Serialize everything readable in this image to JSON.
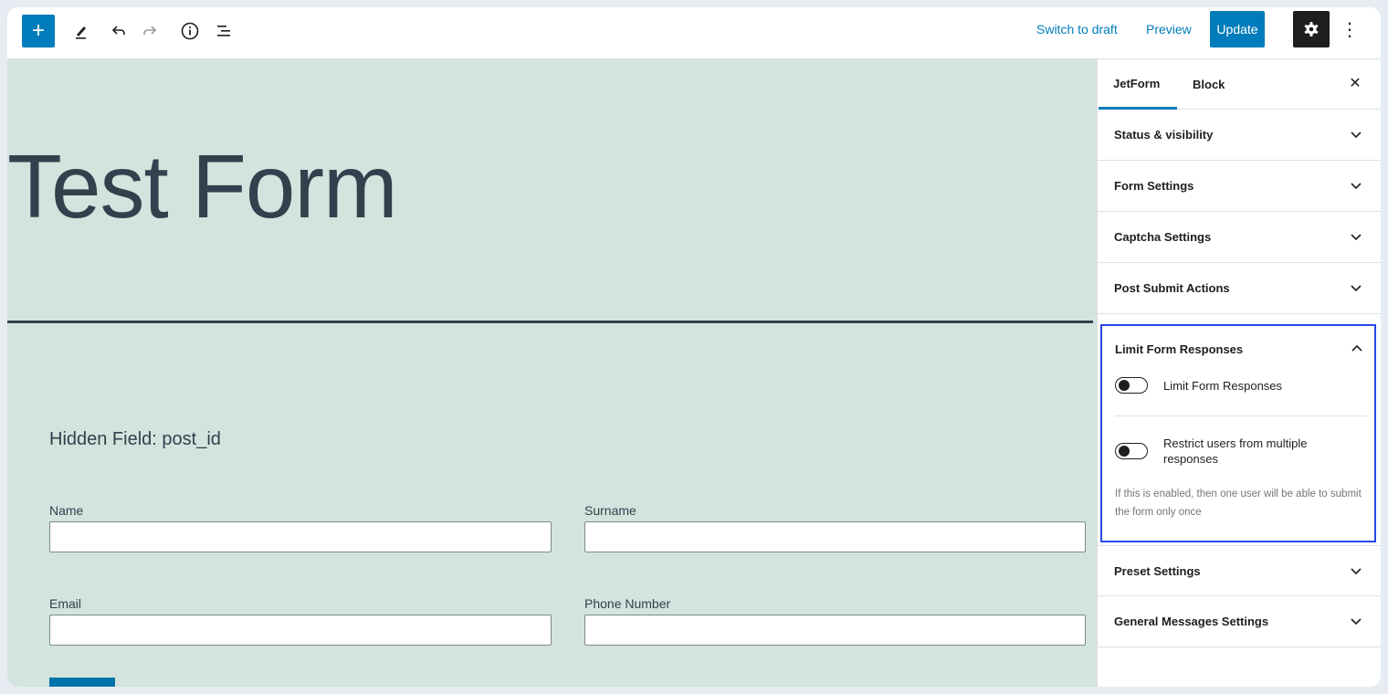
{
  "toolbar": {
    "add_icon": "plus-icon",
    "tools_icon": "pencil-icon",
    "undo_icon": "undo-icon",
    "redo_icon": "redo-icon",
    "info_icon": "info-icon",
    "list_view_icon": "list-view-icon",
    "switch_to_draft": "Switch to draft",
    "preview": "Preview",
    "update": "Update",
    "settings_icon": "gear-icon",
    "more_icon": "kebab-menu-icon",
    "accent_color": "#007cba"
  },
  "editor": {
    "post_title": "Test Form",
    "background_color": "#d2e4dd",
    "hidden_field_label": "Hidden Field: post_id",
    "fields": [
      {
        "label": "Name",
        "value": ""
      },
      {
        "label": "Surname",
        "value": ""
      },
      {
        "label": "Email",
        "value": ""
      },
      {
        "label": "Phone Number",
        "value": ""
      }
    ]
  },
  "sidebar": {
    "tabs": [
      {
        "label": "JetForm",
        "active": true
      },
      {
        "label": "Block",
        "active": false
      }
    ],
    "close_icon": "close-icon",
    "panels_top": [
      {
        "title": "Status & visibility"
      },
      {
        "title": "Form Settings"
      },
      {
        "title": "Captcha Settings"
      },
      {
        "title": "Post Submit Actions"
      }
    ],
    "limit_panel": {
      "title": "Limit Form Responses",
      "highlight_color": "#2848e8",
      "toggle_limit_label": "Limit Form Responses",
      "toggle_limit_on": false,
      "toggle_restrict_label": "Restrict users from multiple responses",
      "toggle_restrict_on": false,
      "help_text": "If this is enabled, then one user will be able to submit the form only once"
    },
    "panels_bottom": [
      {
        "title": "Preset Settings"
      },
      {
        "title": "General Messages Settings"
      }
    ]
  }
}
